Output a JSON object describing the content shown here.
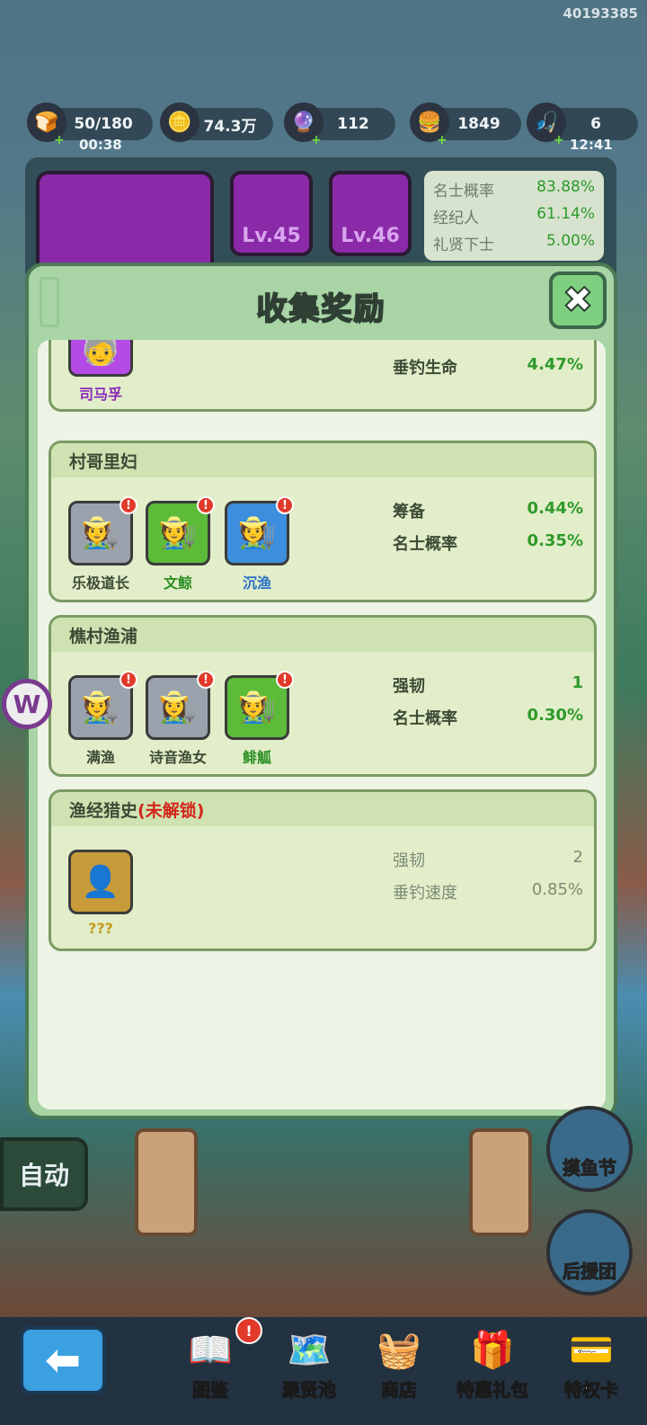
{
  "uid": "40193385",
  "resources": [
    {
      "icon": "🍞",
      "value": "50/180",
      "sub": "00:38",
      "plus": true
    },
    {
      "icon": "🪙",
      "value": "74.3万",
      "sub": "",
      "plus": false
    },
    {
      "icon": "🔮",
      "value": "112",
      "sub": "",
      "plus": true
    },
    {
      "icon": "🍔",
      "value": "1849",
      "sub": "",
      "plus": true
    },
    {
      "icon": "🎣",
      "value": "6",
      "sub": "12:41",
      "plus": true
    }
  ],
  "top_slots": [
    {
      "level": "Lv.45"
    },
    {
      "level": "Lv.46"
    }
  ],
  "top_stats": [
    {
      "name": "名士概率",
      "value": "83.88%"
    },
    {
      "name": "经纪人",
      "value": "61.14%"
    },
    {
      "name": "礼贤下士",
      "value": "5.00%"
    }
  ],
  "modal": {
    "title": "收集奖励",
    "close_label": "✖",
    "groups": [
      {
        "title": "",
        "members": [
          {
            "name": "司马孚",
            "rarity": "purple",
            "badge": false
          }
        ],
        "stats": [
          {
            "name": "垂钓生命",
            "value": "4.47%"
          }
        ]
      },
      {
        "title": "村哥里妇",
        "members": [
          {
            "name": "乐极道长",
            "rarity": "gray",
            "badge": true
          },
          {
            "name": "文鲸",
            "rarity": "green",
            "badge": true
          },
          {
            "name": "沉渔",
            "rarity": "blue",
            "badge": true
          }
        ],
        "stats": [
          {
            "name": "筹备",
            "value": "0.44%"
          },
          {
            "name": "名士概率",
            "value": "0.35%"
          }
        ]
      },
      {
        "title": "樵村渔浦",
        "members": [
          {
            "name": "满渔",
            "rarity": "gray",
            "badge": true
          },
          {
            "name": "诗音渔女",
            "rarity": "gray",
            "badge": true
          },
          {
            "name": "鲱觚",
            "rarity": "green",
            "badge": true
          }
        ],
        "stats": [
          {
            "name": "强韧",
            "value": "1"
          },
          {
            "name": "名士概率",
            "value": "0.30%"
          }
        ]
      },
      {
        "title": "渔经猎史",
        "locked": "(未解锁)",
        "members": [
          {
            "name": "???",
            "rarity": "gold",
            "badge": false
          }
        ],
        "stats": [
          {
            "name": "强韧",
            "value": "2"
          },
          {
            "name": "垂钓速度",
            "value": "0.85%"
          }
        ]
      }
    ]
  },
  "auto_label": "自动",
  "side_buttons": [
    {
      "label": "摸鱼节"
    },
    {
      "label": "后援团"
    }
  ],
  "nav": [
    {
      "label": "图鉴",
      "icon": "📖"
    },
    {
      "label": "聚贤池",
      "icon": "🗺️"
    },
    {
      "label": "商店",
      "icon": "🧺"
    },
    {
      "label": "特惠礼包",
      "icon": "🎁"
    },
    {
      "label": "特权卡",
      "icon": "💳"
    }
  ],
  "badge_mark": "!",
  "back_label": "⬅",
  "watermark_letter": "W"
}
